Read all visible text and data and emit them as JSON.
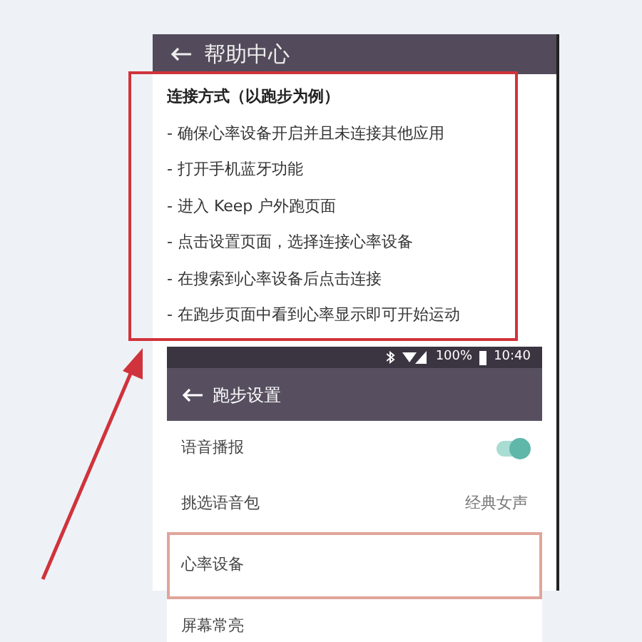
{
  "help_screen": {
    "title": "帮助中心",
    "heading": "连接方式（以跑步为例）",
    "steps": [
      "- 确保心率设备开启并且未连接其他应用",
      "- 打开手机蓝牙功能",
      "- 进入 Keep 户外跑页面",
      "- 点击设置页面，选择连接心率设备",
      "- 在搜索到心率设备后点击连接",
      "- 在跑步页面中看到心率显示即可开始运动"
    ],
    "highlighted": true
  },
  "settings_screen": {
    "status_bar": {
      "battery": "100%",
      "time": "10:40"
    },
    "title": "跑步设置",
    "rows": [
      {
        "kind": "toggle",
        "label": "语音播报",
        "on": true,
        "highlighted": false
      },
      {
        "kind": "value",
        "label": "挑选语音包",
        "value": "经典女声",
        "highlighted": false
      },
      {
        "kind": "plain",
        "label": "心率设备",
        "highlighted": true
      },
      {
        "kind": "plain",
        "label": "屏幕常亮",
        "highlighted": false
      }
    ]
  }
}
